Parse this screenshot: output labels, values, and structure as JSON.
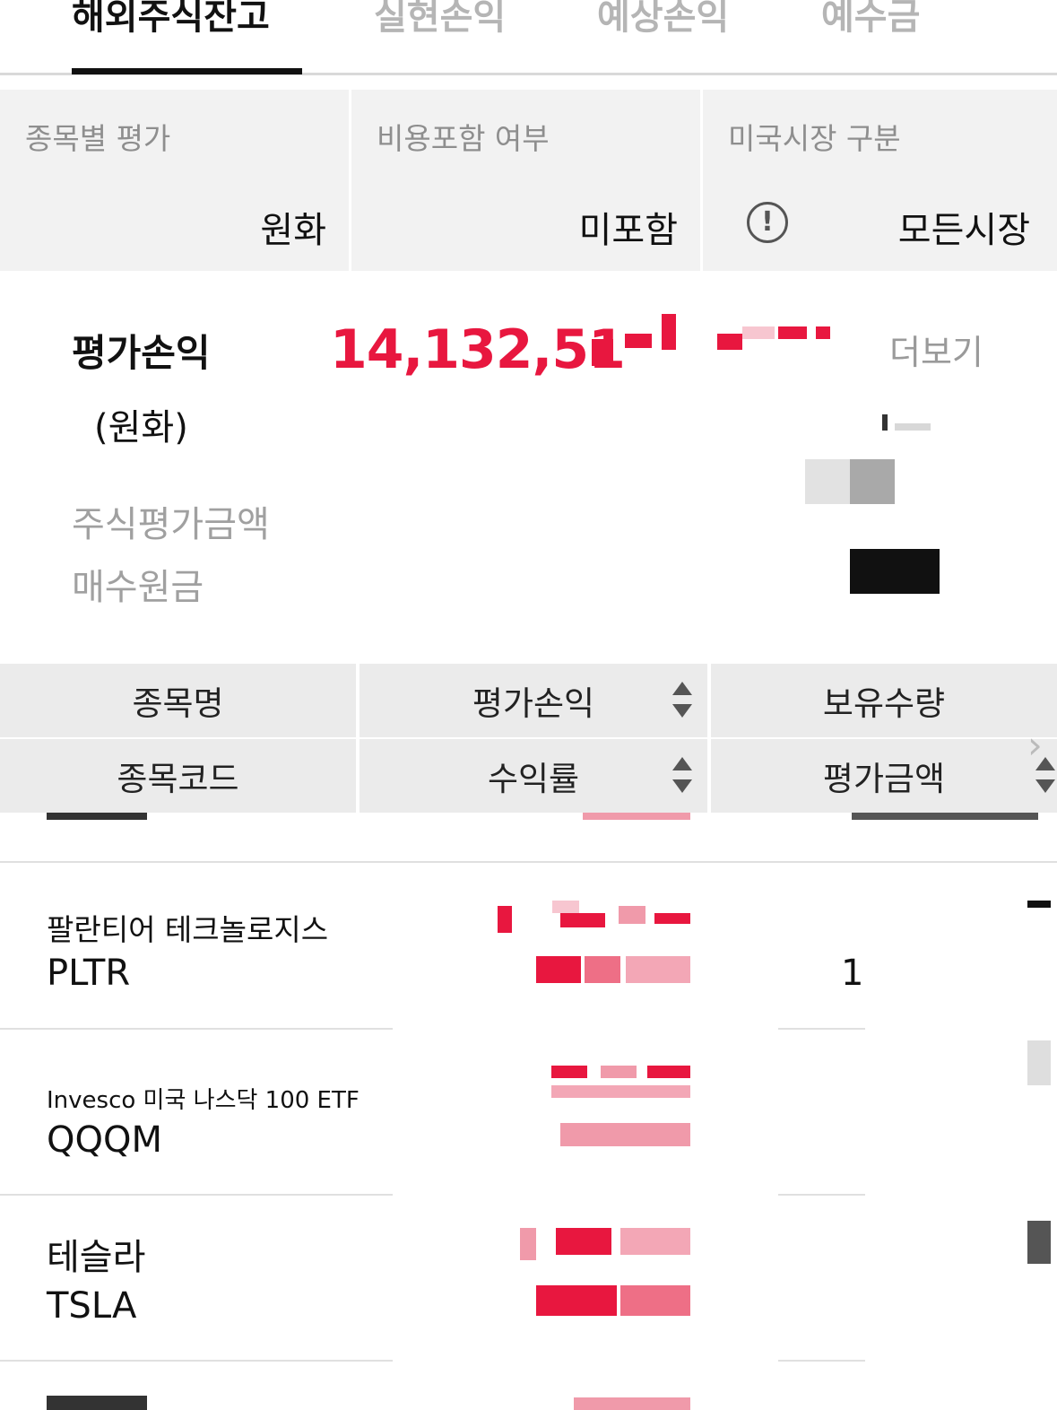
{
  "tabs": [
    {
      "label": "해외주식잔고",
      "active": true
    },
    {
      "label": "실현손익",
      "active": false
    },
    {
      "label": "예상손익",
      "active": false
    },
    {
      "label": "예수금",
      "active": false
    }
  ],
  "filters": [
    {
      "label": "종목별 평가",
      "value": "원화"
    },
    {
      "label": "비용포함 여부",
      "value": "미포함"
    },
    {
      "label": "미국시장 구분",
      "value": "모든시장",
      "icon": "info-icon"
    }
  ],
  "summary": {
    "title": "평가손익",
    "unit": "(원화)",
    "value": "14,132,51",
    "more_label": "더보기",
    "rows": [
      "주식평가금액",
      "매수원금"
    ]
  },
  "table": {
    "headers_top": [
      "종목명",
      "평가손익",
      "보유수량"
    ],
    "headers_bottom": [
      "종목코드",
      "수익률",
      "평가금액"
    ],
    "rows": [
      {
        "name": "팔란티어 테크놀로지스",
        "code": "PLTR",
        "qty": "1"
      },
      {
        "name": "Invesco 미국 나스닥 100 ETF",
        "code": "QQQM"
      },
      {
        "name": "테슬라",
        "code": "TSLA"
      }
    ]
  },
  "colors": {
    "accent_red": "#e8173f",
    "header_bg": "#ebebeb",
    "filter_bg": "#f2f2f2"
  }
}
